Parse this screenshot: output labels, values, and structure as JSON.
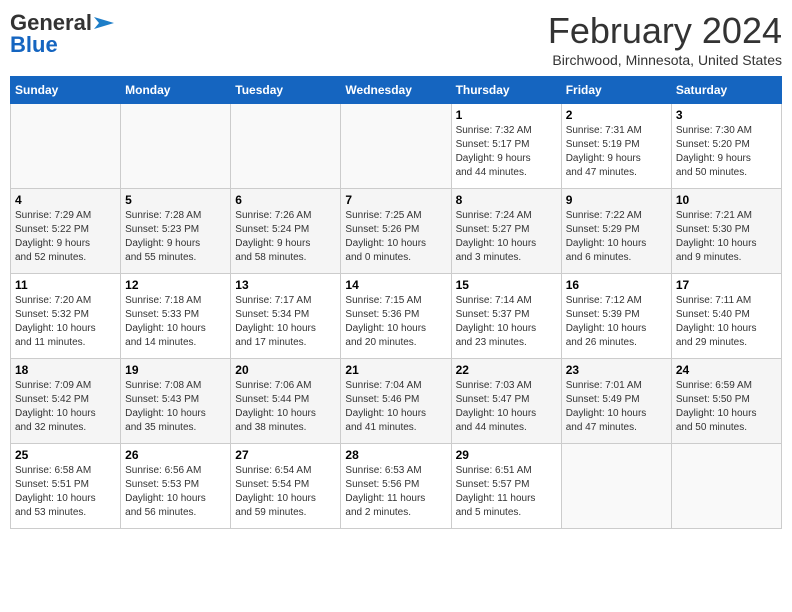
{
  "header": {
    "logo_general": "General",
    "logo_blue": "Blue",
    "month_title": "February 2024",
    "location": "Birchwood, Minnesota, United States"
  },
  "days_of_week": [
    "Sunday",
    "Monday",
    "Tuesday",
    "Wednesday",
    "Thursday",
    "Friday",
    "Saturday"
  ],
  "weeks": [
    [
      {
        "day": "",
        "info": ""
      },
      {
        "day": "",
        "info": ""
      },
      {
        "day": "",
        "info": ""
      },
      {
        "day": "",
        "info": ""
      },
      {
        "day": "1",
        "info": "Sunrise: 7:32 AM\nSunset: 5:17 PM\nDaylight: 9 hours\nand 44 minutes."
      },
      {
        "day": "2",
        "info": "Sunrise: 7:31 AM\nSunset: 5:19 PM\nDaylight: 9 hours\nand 47 minutes."
      },
      {
        "day": "3",
        "info": "Sunrise: 7:30 AM\nSunset: 5:20 PM\nDaylight: 9 hours\nand 50 minutes."
      }
    ],
    [
      {
        "day": "4",
        "info": "Sunrise: 7:29 AM\nSunset: 5:22 PM\nDaylight: 9 hours\nand 52 minutes."
      },
      {
        "day": "5",
        "info": "Sunrise: 7:28 AM\nSunset: 5:23 PM\nDaylight: 9 hours\nand 55 minutes."
      },
      {
        "day": "6",
        "info": "Sunrise: 7:26 AM\nSunset: 5:24 PM\nDaylight: 9 hours\nand 58 minutes."
      },
      {
        "day": "7",
        "info": "Sunrise: 7:25 AM\nSunset: 5:26 PM\nDaylight: 10 hours\nand 0 minutes."
      },
      {
        "day": "8",
        "info": "Sunrise: 7:24 AM\nSunset: 5:27 PM\nDaylight: 10 hours\nand 3 minutes."
      },
      {
        "day": "9",
        "info": "Sunrise: 7:22 AM\nSunset: 5:29 PM\nDaylight: 10 hours\nand 6 minutes."
      },
      {
        "day": "10",
        "info": "Sunrise: 7:21 AM\nSunset: 5:30 PM\nDaylight: 10 hours\nand 9 minutes."
      }
    ],
    [
      {
        "day": "11",
        "info": "Sunrise: 7:20 AM\nSunset: 5:32 PM\nDaylight: 10 hours\nand 11 minutes."
      },
      {
        "day": "12",
        "info": "Sunrise: 7:18 AM\nSunset: 5:33 PM\nDaylight: 10 hours\nand 14 minutes."
      },
      {
        "day": "13",
        "info": "Sunrise: 7:17 AM\nSunset: 5:34 PM\nDaylight: 10 hours\nand 17 minutes."
      },
      {
        "day": "14",
        "info": "Sunrise: 7:15 AM\nSunset: 5:36 PM\nDaylight: 10 hours\nand 20 minutes."
      },
      {
        "day": "15",
        "info": "Sunrise: 7:14 AM\nSunset: 5:37 PM\nDaylight: 10 hours\nand 23 minutes."
      },
      {
        "day": "16",
        "info": "Sunrise: 7:12 AM\nSunset: 5:39 PM\nDaylight: 10 hours\nand 26 minutes."
      },
      {
        "day": "17",
        "info": "Sunrise: 7:11 AM\nSunset: 5:40 PM\nDaylight: 10 hours\nand 29 minutes."
      }
    ],
    [
      {
        "day": "18",
        "info": "Sunrise: 7:09 AM\nSunset: 5:42 PM\nDaylight: 10 hours\nand 32 minutes."
      },
      {
        "day": "19",
        "info": "Sunrise: 7:08 AM\nSunset: 5:43 PM\nDaylight: 10 hours\nand 35 minutes."
      },
      {
        "day": "20",
        "info": "Sunrise: 7:06 AM\nSunset: 5:44 PM\nDaylight: 10 hours\nand 38 minutes."
      },
      {
        "day": "21",
        "info": "Sunrise: 7:04 AM\nSunset: 5:46 PM\nDaylight: 10 hours\nand 41 minutes."
      },
      {
        "day": "22",
        "info": "Sunrise: 7:03 AM\nSunset: 5:47 PM\nDaylight: 10 hours\nand 44 minutes."
      },
      {
        "day": "23",
        "info": "Sunrise: 7:01 AM\nSunset: 5:49 PM\nDaylight: 10 hours\nand 47 minutes."
      },
      {
        "day": "24",
        "info": "Sunrise: 6:59 AM\nSunset: 5:50 PM\nDaylight: 10 hours\nand 50 minutes."
      }
    ],
    [
      {
        "day": "25",
        "info": "Sunrise: 6:58 AM\nSunset: 5:51 PM\nDaylight: 10 hours\nand 53 minutes."
      },
      {
        "day": "26",
        "info": "Sunrise: 6:56 AM\nSunset: 5:53 PM\nDaylight: 10 hours\nand 56 minutes."
      },
      {
        "day": "27",
        "info": "Sunrise: 6:54 AM\nSunset: 5:54 PM\nDaylight: 10 hours\nand 59 minutes."
      },
      {
        "day": "28",
        "info": "Sunrise: 6:53 AM\nSunset: 5:56 PM\nDaylight: 11 hours\nand 2 minutes."
      },
      {
        "day": "29",
        "info": "Sunrise: 6:51 AM\nSunset: 5:57 PM\nDaylight: 11 hours\nand 5 minutes."
      },
      {
        "day": "",
        "info": ""
      },
      {
        "day": "",
        "info": ""
      }
    ]
  ]
}
